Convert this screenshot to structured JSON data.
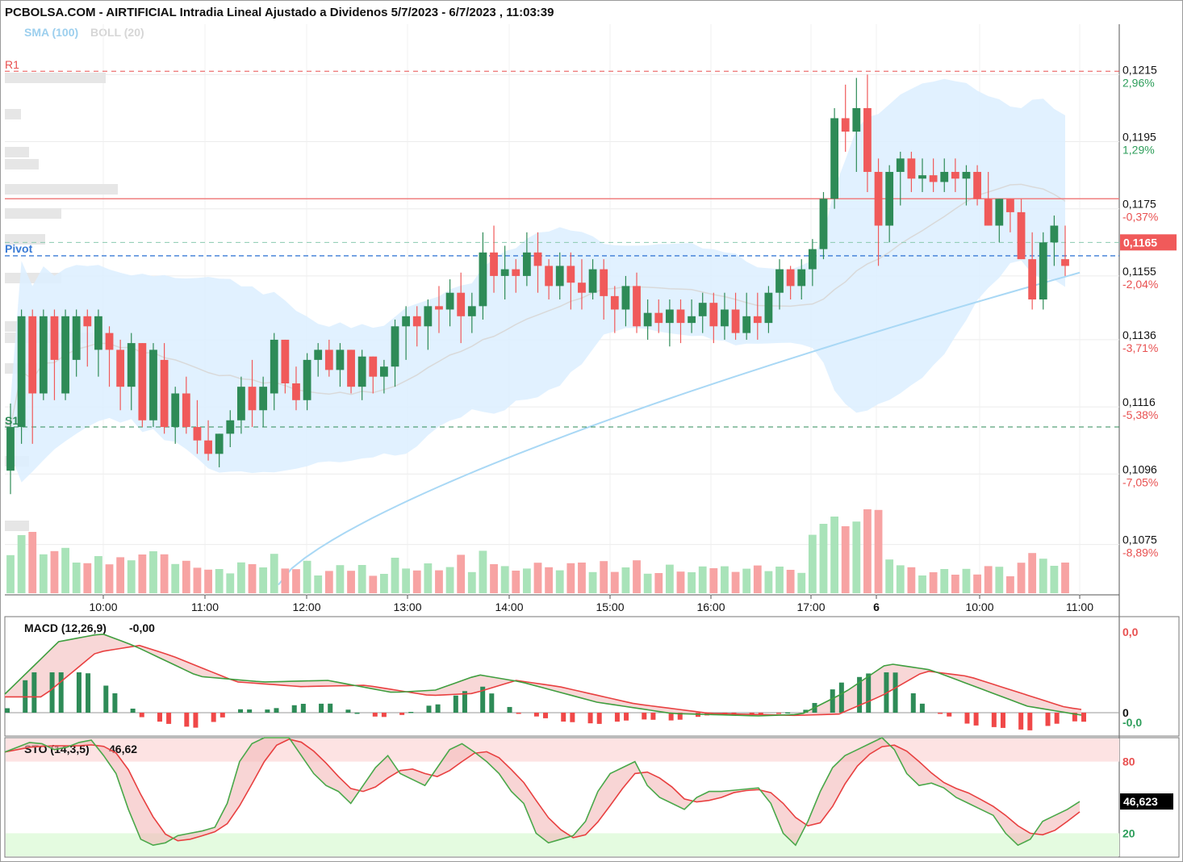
{
  "header": {
    "title": "PCBOLSA.COM - AIRTIFICIAL Intradia Lineal Ajustado a Dividenos 5/7/2023 - 6/7/2023 , 11:03:39",
    "sma_label": "SMA (100)",
    "boll_label": "BOLL (20)"
  },
  "levels": {
    "r1": {
      "label": "R1",
      "value": 0.1216
    },
    "pivot": {
      "label": "Pivot",
      "value": 0.1161
    },
    "s1": {
      "label": "S1",
      "value": 0.111
    },
    "resistance_line": 0.1178
  },
  "price_axis": {
    "ticks": [
      {
        "price": "0,1215",
        "pct": "2,96%",
        "value": 0.1215,
        "color": "#2e9e5b"
      },
      {
        "price": "0,1195",
        "pct": "1,29%",
        "value": 0.1195,
        "color": "#2e9e5b"
      },
      {
        "price": "0,1175",
        "pct": "-0,37%",
        "value": 0.1175,
        "color": "#e85050"
      },
      {
        "price": "0,1155",
        "pct": "-2,04%",
        "value": 0.1155,
        "color": "#e85050"
      },
      {
        "price": "0,1136",
        "pct": "-3,71%",
        "value": 0.1136,
        "color": "#e85050"
      },
      {
        "price": "0,1116",
        "pct": "-5,38%",
        "value": 0.1116,
        "color": "#e85050"
      },
      {
        "price": "0,1096",
        "pct": "-7,05%",
        "value": 0.1096,
        "color": "#e85050"
      },
      {
        "price": "0,1075",
        "pct": "-8,89%",
        "value": 0.1075,
        "color": "#e85050"
      }
    ],
    "last_price": "0,1165",
    "last_value": 0.1165
  },
  "time_axis": [
    "10:00",
    "11:00",
    "12:00",
    "13:00",
    "14:00",
    "15:00",
    "16:00",
    "17:00",
    "6",
    "10:00",
    "11:00"
  ],
  "macd": {
    "label": "MACD (12,26,9)",
    "value": "-0,00",
    "axis_top": "0,0",
    "axis_zero": "0",
    "axis_bottom": "-0,0"
  },
  "sto": {
    "label": "STO (14,3,5)",
    "value": "46,62",
    "axis_80": "80",
    "axis_20": "20",
    "last": "46,623"
  },
  "colors": {
    "up": "#2e8b57",
    "down": "#f05a5a",
    "boll_fill": "#dcefff",
    "sma": "#a9d8f5",
    "pivot": "#3a7bd5",
    "r1": "#e85050",
    "s1": "#2e8b57"
  },
  "chart_data": {
    "type": "candlestick",
    "candles_ohlc": [
      [
        0.1097,
        0.1117,
        0.109,
        0.111
      ],
      [
        0.111,
        0.1145,
        0.1105,
        0.1143
      ],
      [
        0.1143,
        0.1145,
        0.1105,
        0.112
      ],
      [
        0.112,
        0.1145,
        0.1118,
        0.1143
      ],
      [
        0.1143,
        0.1145,
        0.1118,
        0.113
      ],
      [
        0.112,
        0.1145,
        0.1118,
        0.1143
      ],
      [
        0.113,
        0.1145,
        0.1125,
        0.1143
      ],
      [
        0.1143,
        0.1145,
        0.1128,
        0.114
      ],
      [
        0.1133,
        0.1145,
        0.1125,
        0.1143
      ],
      [
        0.1138,
        0.114,
        0.1122,
        0.1133
      ],
      [
        0.1133,
        0.1136,
        0.1115,
        0.1122
      ],
      [
        0.1122,
        0.1138,
        0.1115,
        0.1135
      ],
      [
        0.1135,
        0.1135,
        0.111,
        0.1112
      ],
      [
        0.1112,
        0.1135,
        0.111,
        0.1133
      ],
      [
        0.113,
        0.1135,
        0.1108,
        0.111
      ],
      [
        0.111,
        0.1122,
        0.1105,
        0.112
      ],
      [
        0.112,
        0.1125,
        0.1108,
        0.111
      ],
      [
        0.111,
        0.1118,
        0.1102,
        0.1106
      ],
      [
        0.1106,
        0.1112,
        0.11,
        0.1102
      ],
      [
        0.1102,
        0.1108,
        0.1098,
        0.1108
      ],
      [
        0.1108,
        0.1115,
        0.1104,
        0.1112
      ],
      [
        0.1112,
        0.1125,
        0.1108,
        0.1122
      ],
      [
        0.1122,
        0.113,
        0.111,
        0.1115
      ],
      [
        0.1115,
        0.1125,
        0.111,
        0.1122
      ],
      [
        0.112,
        0.1138,
        0.1115,
        0.1136
      ],
      [
        0.1136,
        0.1136,
        0.112,
        0.1123
      ],
      [
        0.1123,
        0.1128,
        0.1115,
        0.1118
      ],
      [
        0.1118,
        0.1132,
        0.1115,
        0.113
      ],
      [
        0.113,
        0.1135,
        0.1125,
        0.1133
      ],
      [
        0.1133,
        0.1136,
        0.1125,
        0.1127
      ],
      [
        0.1127,
        0.1135,
        0.1122,
        0.1133
      ],
      [
        0.1133,
        0.1133,
        0.112,
        0.1122
      ],
      [
        0.1122,
        0.1133,
        0.1118,
        0.1131
      ],
      [
        0.1131,
        0.1131,
        0.112,
        0.1125
      ],
      [
        0.1125,
        0.113,
        0.112,
        0.1128
      ],
      [
        0.1128,
        0.1142,
        0.1122,
        0.114
      ],
      [
        0.114,
        0.1146,
        0.113,
        0.1143
      ],
      [
        0.1143,
        0.1146,
        0.1134,
        0.114
      ],
      [
        0.114,
        0.1148,
        0.1133,
        0.1146
      ],
      [
        0.1146,
        0.1152,
        0.1138,
        0.1145
      ],
      [
        0.1145,
        0.1154,
        0.114,
        0.115
      ],
      [
        0.115,
        0.1156,
        0.1135,
        0.1143
      ],
      [
        0.1143,
        0.115,
        0.1138,
        0.1146
      ],
      [
        0.1146,
        0.1168,
        0.1142,
        0.1162
      ],
      [
        0.1162,
        0.117,
        0.115,
        0.1155
      ],
      [
        0.1155,
        0.1164,
        0.1148,
        0.1157
      ],
      [
        0.1157,
        0.116,
        0.115,
        0.1155
      ],
      [
        0.1155,
        0.1168,
        0.1152,
        0.1162
      ],
      [
        0.1162,
        0.1168,
        0.115,
        0.1158
      ],
      [
        0.1158,
        0.116,
        0.1148,
        0.1152
      ],
      [
        0.1152,
        0.1162,
        0.1148,
        0.1158
      ],
      [
        0.1158,
        0.1162,
        0.1145,
        0.1153
      ],
      [
        0.1153,
        0.116,
        0.1145,
        0.115
      ],
      [
        0.115,
        0.116,
        0.1148,
        0.1157
      ],
      [
        0.1157,
        0.116,
        0.1142,
        0.1149
      ],
      [
        0.1149,
        0.1152,
        0.1138,
        0.1145
      ],
      [
        0.1145,
        0.1155,
        0.114,
        0.1152
      ],
      [
        0.1152,
        0.1156,
        0.1138,
        0.114
      ],
      [
        0.114,
        0.1148,
        0.1136,
        0.1144
      ],
      [
        0.1144,
        0.1148,
        0.1138,
        0.1141
      ],
      [
        0.1141,
        0.1148,
        0.1134,
        0.1145
      ],
      [
        0.1145,
        0.1148,
        0.1135,
        0.1141
      ],
      [
        0.1141,
        0.1148,
        0.1138,
        0.1143
      ],
      [
        0.1143,
        0.115,
        0.1138,
        0.1147
      ],
      [
        0.1147,
        0.115,
        0.1135,
        0.114
      ],
      [
        0.114,
        0.115,
        0.1136,
        0.1145
      ],
      [
        0.1145,
        0.115,
        0.1136,
        0.1138
      ],
      [
        0.1138,
        0.115,
        0.1136,
        0.1143
      ],
      [
        0.1143,
        0.115,
        0.1136,
        0.1141
      ],
      [
        0.1141,
        0.1152,
        0.1138,
        0.115
      ],
      [
        0.115,
        0.116,
        0.1145,
        0.1157
      ],
      [
        0.1157,
        0.1158,
        0.1148,
        0.1152
      ],
      [
        0.1152,
        0.116,
        0.1148,
        0.1157
      ],
      [
        0.1157,
        0.1166,
        0.1152,
        0.1163
      ],
      [
        0.1163,
        0.118,
        0.116,
        0.1178
      ],
      [
        0.1178,
        0.1205,
        0.1175,
        0.1202
      ],
      [
        0.1202,
        0.1212,
        0.1192,
        0.1198
      ],
      [
        0.1198,
        0.1214,
        0.1186,
        0.1205
      ],
      [
        0.1205,
        0.1215,
        0.118,
        0.1186
      ],
      [
        0.1186,
        0.119,
        0.1158,
        0.117
      ],
      [
        0.117,
        0.1188,
        0.1165,
        0.1186
      ],
      [
        0.1186,
        0.1192,
        0.1176,
        0.119
      ],
      [
        0.119,
        0.1192,
        0.118,
        0.1184
      ],
      [
        0.1184,
        0.119,
        0.118,
        0.1185
      ],
      [
        0.1185,
        0.119,
        0.118,
        0.1183
      ],
      [
        0.1183,
        0.119,
        0.118,
        0.1186
      ],
      [
        0.1186,
        0.119,
        0.118,
        0.1184
      ],
      [
        0.1184,
        0.1188,
        0.1176,
        0.1186
      ],
      [
        0.1186,
        0.1188,
        0.1176,
        0.1178
      ],
      [
        0.1178,
        0.1186,
        0.117,
        0.117
      ],
      [
        0.117,
        0.1178,
        0.1165,
        0.1178
      ],
      [
        0.1178,
        0.1178,
        0.1168,
        0.1174
      ],
      [
        0.1174,
        0.1178,
        0.116,
        0.116
      ],
      [
        0.116,
        0.1168,
        0.1145,
        0.1148
      ],
      [
        0.1148,
        0.1168,
        0.1145,
        0.1165
      ],
      [
        0.1165,
        0.1173,
        0.1158,
        0.117
      ],
      [
        0.116,
        0.117,
        0.1155,
        0.1158
      ]
    ],
    "volume_up": true
  }
}
